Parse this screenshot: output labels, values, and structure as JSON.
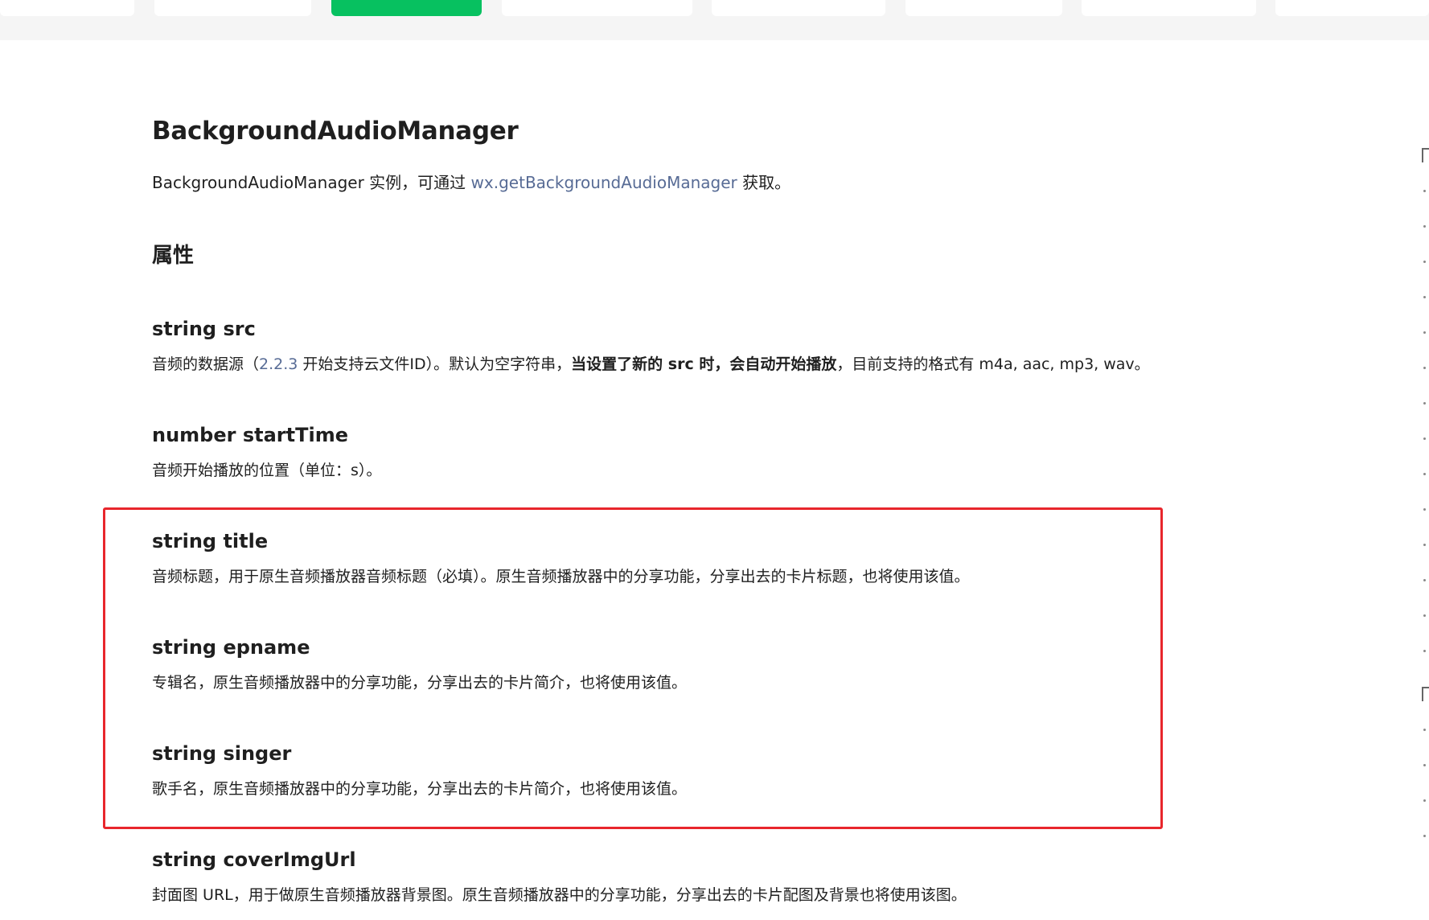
{
  "tabs": [
    {
      "label": "",
      "active": false
    },
    {
      "label": "",
      "active": false
    },
    {
      "label": "",
      "active": true
    },
    {
      "label": "",
      "active": false
    },
    {
      "label": "",
      "active": false
    },
    {
      "label": "",
      "active": false
    },
    {
      "label": "",
      "active": false
    },
    {
      "label": "",
      "active": false
    }
  ],
  "doc": {
    "title": "BackgroundAudioManager",
    "intro": {
      "before": "BackgroundAudioManager 实例，可通过 ",
      "link": "wx.getBackgroundAudioManager",
      "after": " 获取。"
    },
    "section_title": "属性",
    "properties": [
      {
        "name": "string src",
        "desc_before": "音频的数据源（",
        "desc_link": "2.2.3",
        "desc_mid": " 开始支持云文件ID）。默认为空字符串，",
        "desc_bold": "当设置了新的 src 时，会自动开始播放",
        "desc_after": "，目前支持的格式有 m4a, aac, mp3, wav。"
      },
      {
        "name": "number startTime",
        "desc": "音频开始播放的位置（单位：s）。"
      },
      {
        "name": "string title",
        "desc": "音频标题，用于原生音频播放器音频标题（必填）。原生音频播放器中的分享功能，分享出去的卡片标题，也将使用该值。"
      },
      {
        "name": "string epname",
        "desc": "专辑名，原生音频播放器中的分享功能，分享出去的卡片简介，也将使用该值。"
      },
      {
        "name": "string singer",
        "desc": "歌手名，原生音频播放器中的分享功能，分享出去的卡片简介，也将使用该值。"
      },
      {
        "name": "string coverImgUrl",
        "desc": "封面图 URL，用于做原生音频播放器背景图。原生音频播放器中的分享功能，分享出去的卡片配图及背景也将使用该图。"
      }
    ]
  },
  "colors": {
    "active_tab": "#07c160",
    "link": "#576b95",
    "highlight": "#e8262c"
  }
}
